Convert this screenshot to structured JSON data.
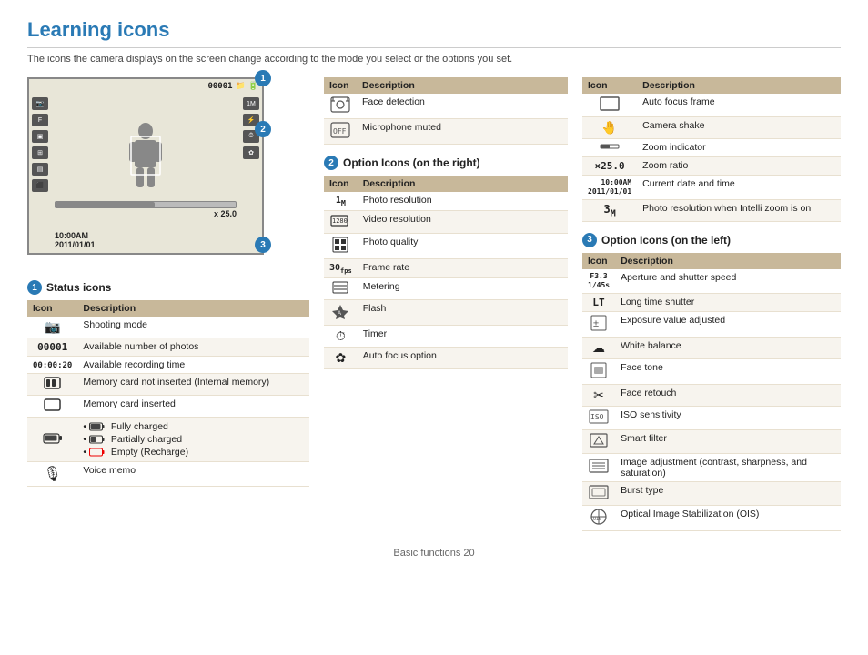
{
  "page": {
    "title": "Learning icons",
    "subtitle": "The icons the camera displays on the screen change according to the mode you select or the options you set.",
    "footer": "Basic functions  20"
  },
  "camera_preview": {
    "top_bar": "00001",
    "zoom_label": "x 25.0",
    "datetime_line1": "10:00AM",
    "datetime_line2": "2011/01/01"
  },
  "status_icons": {
    "section_title": "Status icons",
    "col_icon": "Icon",
    "col_desc": "Description",
    "rows": [
      {
        "icon": "📷",
        "icon_text": "",
        "desc": "Shooting mode"
      },
      {
        "icon": "",
        "icon_text": "00001",
        "desc": "Available number of photos"
      },
      {
        "icon": "",
        "icon_text": "00:00:20",
        "desc": "Available recording time"
      },
      {
        "icon": "",
        "icon_text": "🗂",
        "desc": "Memory card not inserted (Internal memory)"
      },
      {
        "icon": "",
        "icon_text": "☐",
        "desc": "Memory card inserted"
      },
      {
        "icon": "",
        "icon_text": "battery",
        "desc_list": [
          "🔋 Fully charged",
          "🔋 Partially charged",
          "🔴 Empty (Recharge)"
        ]
      },
      {
        "icon": "",
        "icon_text": "🎙",
        "desc": "Voice memo"
      }
    ]
  },
  "option_icons_right": {
    "section_num": "2",
    "section_title": "Option Icons (on the right)",
    "col_icon": "Icon",
    "col_desc": "Description",
    "rows": [
      {
        "icon_text": "1M",
        "desc": "Photo resolution"
      },
      {
        "icon_text": "1280",
        "desc": "Video resolution"
      },
      {
        "icon_text": "⊞",
        "desc": "Photo quality"
      },
      {
        "icon_text": "30",
        "desc": "Frame rate"
      },
      {
        "icon_text": "☰",
        "desc": "Metering"
      },
      {
        "icon_text": "⚡A",
        "desc": "Flash"
      },
      {
        "icon_text": "⏱",
        "desc": "Timer"
      },
      {
        "icon_text": "✿",
        "desc": "Auto focus option"
      }
    ]
  },
  "option_icons_face_right": {
    "rows": [
      {
        "icon_text": "👁",
        "desc": "Auto focus frame"
      },
      {
        "icon_text": "🤚",
        "desc": "Camera shake"
      },
      {
        "icon_text": "▬",
        "desc": "Zoom indicator"
      },
      {
        "icon_text": "×25.0",
        "desc": "Zoom ratio"
      },
      {
        "icon_text": "10:00AM\n2011/01/01",
        "desc": "Current date and time"
      },
      {
        "icon_text": "3M",
        "desc": "Photo resolution when Intelli zoom is on"
      }
    ]
  },
  "option_icons_left": {
    "section_num": "3",
    "section_title": "Option Icons (on the left)",
    "col_icon": "Icon",
    "col_desc": "Description",
    "rows": [
      {
        "icon_text": "F3.3\n1/45s",
        "desc": "Aperture and shutter speed"
      },
      {
        "icon_text": "LT",
        "desc": "Long time shutter"
      },
      {
        "icon_text": "±",
        "desc": "Exposure value adjusted"
      },
      {
        "icon_text": "☁",
        "desc": "White balance"
      },
      {
        "icon_text": "⬛",
        "desc": "Face tone"
      },
      {
        "icon_text": "✂",
        "desc": "Face retouch"
      },
      {
        "icon_text": "ISO",
        "desc": "ISO sensitivity"
      },
      {
        "icon_text": "🎞",
        "desc": "Smart filter"
      },
      {
        "icon_text": "⊡",
        "desc": "Image adjustment (contrast, sharpness, and saturation)"
      },
      {
        "icon_text": "⬜",
        "desc": "Burst type"
      },
      {
        "icon_text": "OIS",
        "desc": "Optical Image Stabilization (OIS)"
      }
    ]
  },
  "mid_top_table": {
    "col_icon": "Icon",
    "col_desc": "Description"
  }
}
